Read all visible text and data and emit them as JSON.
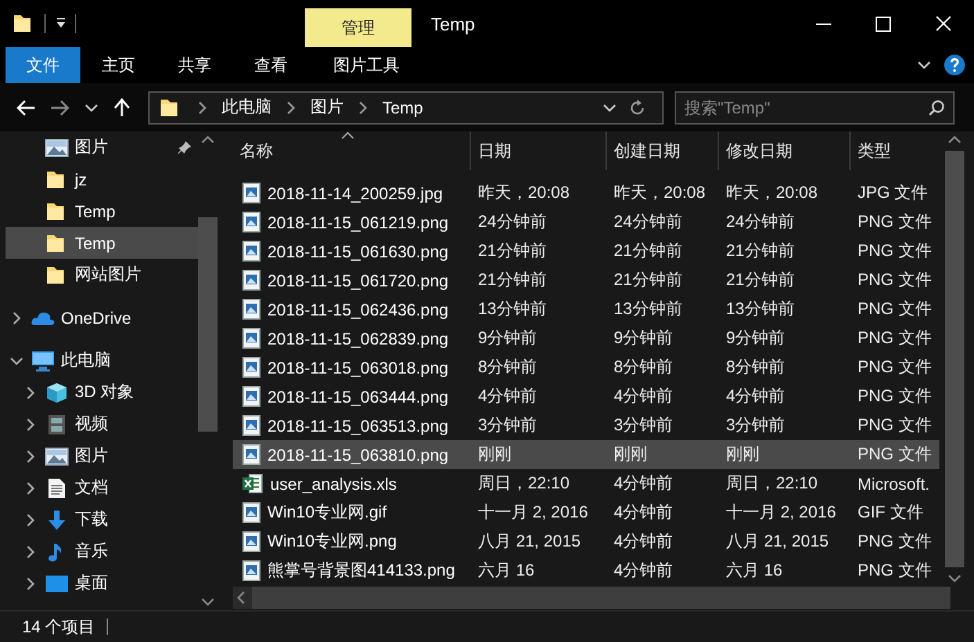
{
  "window": {
    "title": "Temp",
    "context_tab": "管理"
  },
  "ribbon": {
    "tabs": [
      {
        "label": "文件",
        "kind": "file"
      },
      {
        "label": "主页",
        "kind": "tab"
      },
      {
        "label": "共享",
        "kind": "tab"
      },
      {
        "label": "查看",
        "kind": "tab"
      },
      {
        "label": "图片工具",
        "kind": "context"
      }
    ]
  },
  "address": {
    "crumbs": [
      "此电脑",
      "图片",
      "Temp"
    ]
  },
  "search": {
    "placeholder": "搜索\"Temp\""
  },
  "nav_pane": {
    "quick_access": [
      {
        "label": "图片",
        "kind": "pictures",
        "pinned": true,
        "selected": false
      },
      {
        "label": "jz",
        "kind": "folder",
        "pinned": false,
        "selected": false
      },
      {
        "label": "Temp",
        "kind": "folder",
        "pinned": false,
        "selected": false
      },
      {
        "label": "Temp",
        "kind": "folder",
        "pinned": false,
        "selected": true
      },
      {
        "label": "网站图片",
        "kind": "folder",
        "pinned": false,
        "selected": false
      }
    ],
    "tree": [
      {
        "label": "OneDrive",
        "kind": "cloud",
        "expanded": false
      },
      {
        "label": "此电脑",
        "kind": "computer",
        "expanded": true,
        "children": [
          {
            "label": "3D 对象",
            "kind": "cube",
            "expanded": false
          },
          {
            "label": "视频",
            "kind": "video",
            "expanded": false
          },
          {
            "label": "图片",
            "kind": "pictures",
            "expanded": false
          },
          {
            "label": "文档",
            "kind": "document",
            "expanded": false
          },
          {
            "label": "下载",
            "kind": "download",
            "expanded": false
          },
          {
            "label": "音乐",
            "kind": "music",
            "expanded": false
          },
          {
            "label": "桌面",
            "kind": "desktop",
            "expanded": false
          }
        ]
      }
    ]
  },
  "file_list": {
    "columns": [
      {
        "label": "名称",
        "sorted": true
      },
      {
        "label": "日期",
        "sorted": false
      },
      {
        "label": "创建日期",
        "sorted": false
      },
      {
        "label": "修改日期",
        "sorted": false
      },
      {
        "label": "类型",
        "sorted": false
      }
    ],
    "rows": [
      {
        "kind": "image",
        "name": "2018-11-14_200259.jpg",
        "date": "昨天，20:08",
        "created": "昨天，20:08",
        "modified": "昨天，20:08",
        "type": "JPG 文件",
        "selected": false
      },
      {
        "kind": "image",
        "name": "2018-11-15_061219.png",
        "date": "24分钟前",
        "created": "24分钟前",
        "modified": "24分钟前",
        "type": "PNG 文件",
        "selected": false
      },
      {
        "kind": "image",
        "name": "2018-11-15_061630.png",
        "date": "21分钟前",
        "created": "21分钟前",
        "modified": "21分钟前",
        "type": "PNG 文件",
        "selected": false
      },
      {
        "kind": "image",
        "name": "2018-11-15_061720.png",
        "date": "21分钟前",
        "created": "21分钟前",
        "modified": "21分钟前",
        "type": "PNG 文件",
        "selected": false
      },
      {
        "kind": "image",
        "name": "2018-11-15_062436.png",
        "date": "13分钟前",
        "created": "13分钟前",
        "modified": "13分钟前",
        "type": "PNG 文件",
        "selected": false
      },
      {
        "kind": "image",
        "name": "2018-11-15_062839.png",
        "date": "9分钟前",
        "created": "9分钟前",
        "modified": "9分钟前",
        "type": "PNG 文件",
        "selected": false
      },
      {
        "kind": "image",
        "name": "2018-11-15_063018.png",
        "date": "8分钟前",
        "created": "8分钟前",
        "modified": "8分钟前",
        "type": "PNG 文件",
        "selected": false
      },
      {
        "kind": "image",
        "name": "2018-11-15_063444.png",
        "date": "4分钟前",
        "created": "4分钟前",
        "modified": "4分钟前",
        "type": "PNG 文件",
        "selected": false
      },
      {
        "kind": "image",
        "name": "2018-11-15_063513.png",
        "date": "3分钟前",
        "created": "3分钟前",
        "modified": "3分钟前",
        "type": "PNG 文件",
        "selected": false
      },
      {
        "kind": "image",
        "name": "2018-11-15_063810.png",
        "date": "刚刚",
        "created": "刚刚",
        "modified": "刚刚",
        "type": "PNG 文件",
        "selected": true
      },
      {
        "kind": "spreadsheet",
        "name": "user_analysis.xls",
        "date": "周日，22:10",
        "created": "4分钟前",
        "modified": "周日，22:10",
        "type": "Microsoft.",
        "selected": false
      },
      {
        "kind": "image",
        "name": "Win10专业网.gif",
        "date": "十一月 2, 2016",
        "created": "4分钟前",
        "modified": "十一月 2, 2016",
        "type": "GIF 文件",
        "selected": false
      },
      {
        "kind": "image",
        "name": "Win10专业网.png",
        "date": "八月 21, 2015",
        "created": "4分钟前",
        "modified": "八月 21, 2015",
        "type": "PNG 文件",
        "selected": false
      },
      {
        "kind": "image",
        "name": "熊掌号背景图414133.png",
        "date": "六月 16",
        "created": "4分钟前",
        "modified": "六月 16",
        "type": "PNG 文件",
        "selected": false
      }
    ]
  },
  "status_bar": {
    "item_count": "14 个项目"
  }
}
